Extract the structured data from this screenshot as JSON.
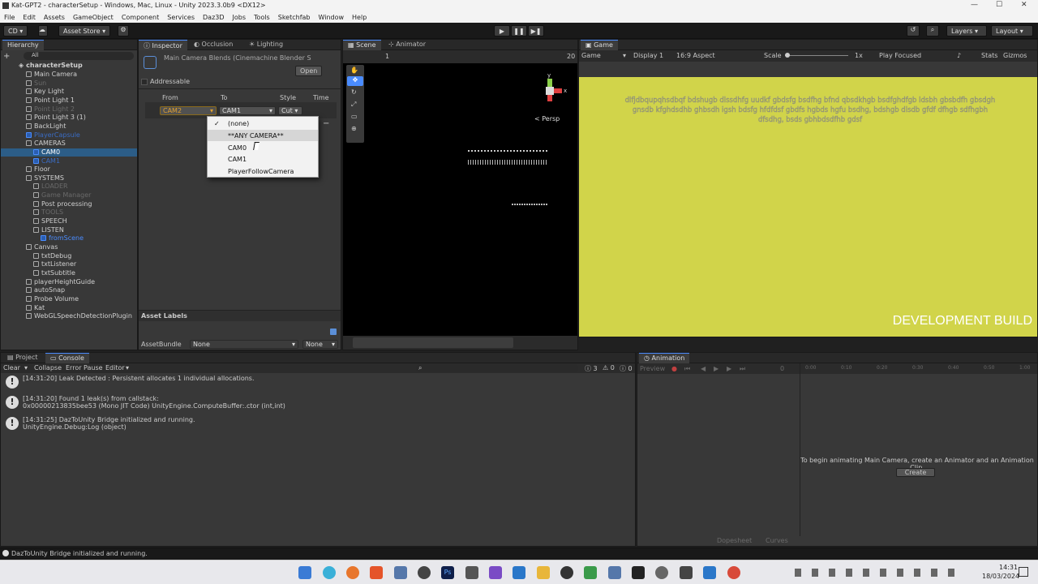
{
  "window": {
    "title": "Kat-GPT2 - characterSetup - Windows, Mac, Linux - Unity 2023.3.0b9 <DX12>",
    "minimize": "—",
    "maximize": "☐",
    "close": "✕"
  },
  "menubar": [
    "File",
    "Edit",
    "Assets",
    "GameObject",
    "Component",
    "Services",
    "Daz3D",
    "Jobs",
    "Tools",
    "Sketchfab",
    "Window",
    "Help"
  ],
  "toolbar": {
    "account": "CD ▾",
    "asset_store": "Asset Store ▾",
    "layers": "Layers",
    "layout": "Layout",
    "play": "▶",
    "pause": "❚❚",
    "step": "▶❚"
  },
  "hierarchy": {
    "tab": "Hierarchy",
    "search": "All",
    "scene": "characterSetup",
    "items": [
      {
        "label": "Main Camera",
        "state": "normal"
      },
      {
        "label": "Sun",
        "state": "dim"
      },
      {
        "label": "Key Light",
        "state": "normal"
      },
      {
        "label": "Point Light 1",
        "state": "normal"
      },
      {
        "label": "Point Light 2",
        "state": "dim"
      },
      {
        "label": "Point Light 3 (1)",
        "state": "normal"
      },
      {
        "label": "BackLight",
        "state": "normal"
      },
      {
        "label": "PlayerCapsule",
        "state": "blue-dim"
      },
      {
        "label": "CAMERAS",
        "state": "normal"
      },
      {
        "label": "CAM0",
        "state": "blue"
      },
      {
        "label": "CAM1",
        "state": "blue-dim"
      },
      {
        "label": "Floor",
        "state": "normal"
      },
      {
        "label": "SYSTEMS",
        "state": "normal"
      },
      {
        "label": "LOADER",
        "state": "dim"
      },
      {
        "label": "Game Manager",
        "state": "dim"
      },
      {
        "label": "Post processing",
        "state": "normal"
      },
      {
        "label": "TOOLS",
        "state": "dim"
      },
      {
        "label": "SPEECH",
        "state": "normal"
      },
      {
        "label": "LISTEN",
        "state": "normal"
      },
      {
        "label": "fromScene",
        "state": "blue"
      },
      {
        "label": "Canvas",
        "state": "normal"
      },
      {
        "label": "txtDebug",
        "state": "normal"
      },
      {
        "label": "txtListener",
        "state": "normal"
      },
      {
        "label": "txtSubtitle",
        "state": "normal"
      },
      {
        "label": "playerHeightGuide",
        "state": "normal"
      },
      {
        "label": "autoSnap",
        "state": "normal"
      },
      {
        "label": "Probe Volume",
        "state": "normal"
      },
      {
        "label": "Kat",
        "state": "normal"
      },
      {
        "label": "WebGLSpeechDetectionPlugin",
        "state": "normal"
      }
    ]
  },
  "inspector": {
    "tabs": [
      "Inspector",
      "Occlusion",
      "Lighting"
    ],
    "title": "Main Camera Blends (Cinemachine Blender S",
    "addressable": "Addressable",
    "open": "Open",
    "columns": [
      "From",
      "To",
      "Style",
      "Time"
    ],
    "row": {
      "from": "CAM2",
      "to": "CAM1",
      "style": "Cut"
    },
    "asset_labels": "Asset Labels",
    "assetbundle_label": "AssetBundle",
    "assetbundle_value": "None",
    "variant_value": "None"
  },
  "dropdown": {
    "options": [
      "(none)",
      "**ANY CAMERA**",
      "CAM0",
      "CAM1",
      "PlayerFollowCamera"
    ],
    "checked": "(none)"
  },
  "scene": {
    "tabs": [
      "Scene",
      "Animator"
    ],
    "persp": "< Persp",
    "zoom": "1",
    "gizmo_y": "y",
    "gizmo_x": "x",
    "gizmo_z": "z",
    "num": "20"
  },
  "game": {
    "tab": "Game",
    "mode": "Game",
    "display": "Display 1",
    "aspect": "16:9 Aspect",
    "scale": "Scale",
    "scale_val": "1x",
    "play_focused": "Play Focused",
    "stats": "Stats",
    "gizmos": "Gizmos",
    "garbled_text": "dlfjdbqupqhsdbqf bdshugb dlssdhfg uudkf gbdsfg bsdfhg bfnd qbsdkhgb bsdfghdfgb ldsbh gbsbdfh gbsdgh gnsdb kfghdsdhb ghbsdh igsh bdsfg hfdfdsf gbdfs hgbds hgfu bsdhg, bdshgb dlsdb gfdf dfhgb sdfhgbh dfsdhg, bsds gbhbdsdfhb gdsf",
    "dev_build": "DEVELOPMENT BUILD",
    "bg": "#d1d44a"
  },
  "console": {
    "tabs": [
      "Project",
      "Console"
    ],
    "clear": "Clear",
    "collapse": "Collapse",
    "error_pause": "Error Pause",
    "editor": "Editor",
    "count_info": "3",
    "count_warn": "0",
    "count_err": "0",
    "messages": [
      {
        "l1": "[14:31:20] Leak Detected : Persistent allocates 1 individual allocations.",
        "l2": ""
      },
      {
        "l1": "[14:31:20] Found 1 leak(s) from callstack:",
        "l2": "0x00000213835bee53 (Mono JIT Code) UnityEngine.ComputeBuffer:.ctor (int,int)"
      },
      {
        "l1": "[14:31:25] DazToUnity Bridge initialized and running.",
        "l2": "UnityEngine.Debug:Log (object)"
      }
    ]
  },
  "animation": {
    "tab": "Animation",
    "preview": "Preview",
    "frame": "0",
    "ticks": [
      "0:00",
      "0:10",
      "0:20",
      "0:30",
      "0:40",
      "0:50",
      "1:00"
    ],
    "hint": "To begin animating Main Camera, create an Animator and an Animation Clip.",
    "create": "Create",
    "dopesheet": "Dopesheet",
    "curves": "Curves"
  },
  "status": "DazToUnity Bridge initialized and running.",
  "taskbar": {
    "time": "14:31",
    "date": "18/03/2024"
  },
  "colors": {
    "accent": "#4a8cff",
    "highlight": "#d08a1a"
  }
}
